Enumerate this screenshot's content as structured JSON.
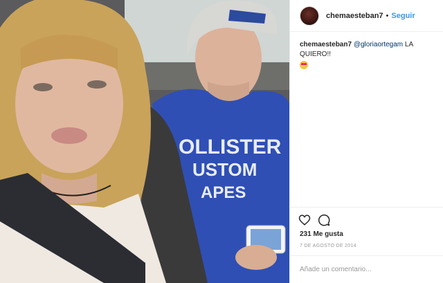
{
  "post": {
    "username": "chemaesteban7",
    "separator": "•",
    "follow_label": "Seguir",
    "caption": {
      "username": "chemaesteban7",
      "mention": "@gloriaortegam",
      "text": "LA QUIERO!!",
      "emoji": "heart-eyes-emoji"
    },
    "likes": "231 Me gusta",
    "date": "7 DE AGOSTO DE 2014",
    "comment_placeholder": "Añade un comentario..."
  },
  "photo": {
    "shirt_text": [
      "OLLISTER",
      "USTOM",
      "APES"
    ],
    "colors": {
      "shirt": "#2f4fb5",
      "hair": "#c9a35a",
      "skin": "#e0b8a0"
    }
  },
  "colors": {
    "accent": "#3897f0",
    "text": "#262626",
    "muted": "#999999",
    "border": "#efefef"
  }
}
